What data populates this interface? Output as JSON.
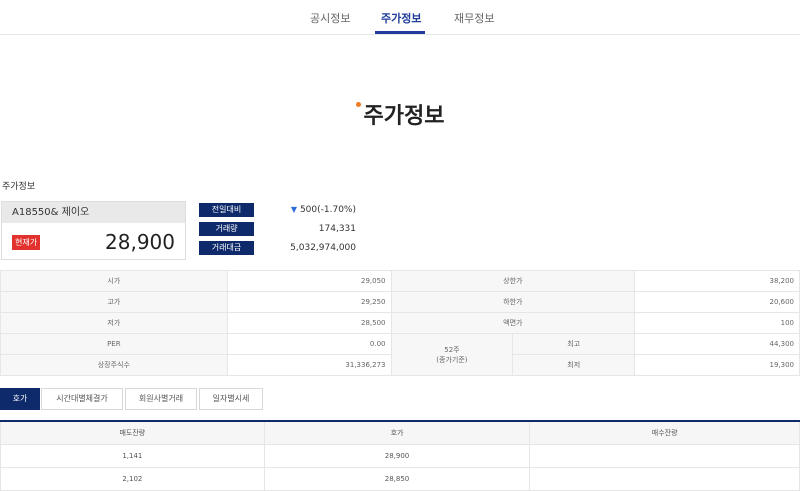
{
  "nav": {
    "tabs": [
      "공시정보",
      "주가정보",
      "재무정보"
    ],
    "active_tab": "주가정보"
  },
  "page_title": "주가정보",
  "section_title": "주가정보",
  "stock": {
    "code_name": "A18550& 제이오",
    "current_label": "현재가",
    "price": "28,900"
  },
  "stats": [
    {
      "label": "전일대비",
      "value": "500(-1.70%)",
      "direction": "down"
    },
    {
      "label": "거래량",
      "value": "174,331"
    },
    {
      "label": "거래대금",
      "value": "5,032,974,000"
    }
  ],
  "info": {
    "open": {
      "label": "시가",
      "value": "29,050"
    },
    "upper_limit": {
      "label": "상한가",
      "value": "38,200"
    },
    "high": {
      "label": "고가",
      "value": "29,250"
    },
    "lower_limit": {
      "label": "하한가",
      "value": "20,600"
    },
    "low": {
      "label": "저가",
      "value": "28,500"
    },
    "par": {
      "label": "액면가",
      "value": "100"
    },
    "per": {
      "label": "PER",
      "value": "0.00"
    },
    "shares": {
      "label": "상장주식수",
      "value": "31,336,273"
    },
    "week52_line1": "52주",
    "week52_line2": "(종가기준)",
    "w52_high": {
      "label": "최고",
      "value": "44,300"
    },
    "w52_low": {
      "label": "최저",
      "value": "19,300"
    }
  },
  "subtabs": [
    "호가",
    "시간대별체결가",
    "회원사별거래",
    "일자별시세"
  ],
  "hoga": {
    "headers": [
      "매도잔량",
      "호가",
      "매수잔량"
    ],
    "rows": [
      [
        "1,141",
        "28,900",
        ""
      ],
      [
        "2,102",
        "28,850",
        ""
      ]
    ]
  },
  "colors": {
    "navy": "#0e2a6b",
    "accent": "#1f3d99",
    "down": "#2c6cd8",
    "badge": "#e1322e",
    "dot": "#f07a23"
  }
}
